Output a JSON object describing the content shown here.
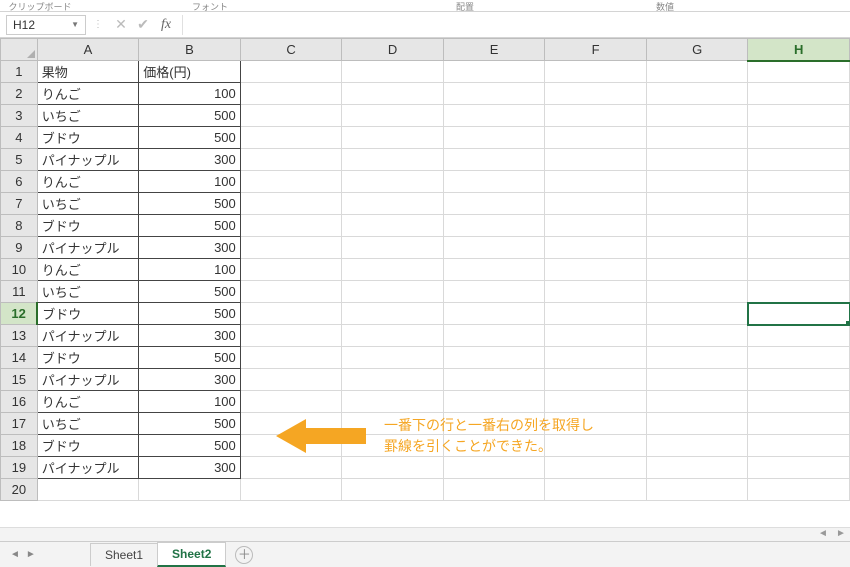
{
  "ribbon_groups": {
    "g1": "クリップボード",
    "g2": "フォント",
    "g3": "配置",
    "g4": "数値",
    "g5": ""
  },
  "name_box": "H12",
  "fx_label": "fx",
  "formula_value": "",
  "columns": [
    "A",
    "B",
    "C",
    "D",
    "E",
    "F",
    "G",
    "H"
  ],
  "row_count": 20,
  "active": {
    "row": 12,
    "col": "H"
  },
  "table": {
    "header": {
      "a": "果物",
      "b": "価格(円)"
    },
    "rows": [
      {
        "a": "りんご",
        "b": "100"
      },
      {
        "a": "いちご",
        "b": "500"
      },
      {
        "a": "ブドウ",
        "b": "500"
      },
      {
        "a": "パイナップル",
        "b": "300"
      },
      {
        "a": "りんご",
        "b": "100"
      },
      {
        "a": "いちご",
        "b": "500"
      },
      {
        "a": "ブドウ",
        "b": "500"
      },
      {
        "a": "パイナップル",
        "b": "300"
      },
      {
        "a": "りんご",
        "b": "100"
      },
      {
        "a": "いちご",
        "b": "500"
      },
      {
        "a": "ブドウ",
        "b": "500"
      },
      {
        "a": "パイナップル",
        "b": "300"
      },
      {
        "a": "ブドウ",
        "b": "500"
      },
      {
        "a": "パイナップル",
        "b": "300"
      },
      {
        "a": "りんご",
        "b": "100"
      },
      {
        "a": "いちご",
        "b": "500"
      },
      {
        "a": "ブドウ",
        "b": "500"
      },
      {
        "a": "パイナップル",
        "b": "300"
      }
    ]
  },
  "callout": {
    "line1": "一番下の行と一番右の列を取得し",
    "line2": "罫線を引くことができた。"
  },
  "tabs": {
    "sheet1": "Sheet1",
    "sheet2": "Sheet2",
    "add": "＋"
  },
  "chart_data": {
    "type": "table",
    "columns": [
      "果物",
      "価格(円)"
    ],
    "rows": [
      [
        "りんご",
        100
      ],
      [
        "いちご",
        500
      ],
      [
        "ブドウ",
        500
      ],
      [
        "パイナップル",
        300
      ],
      [
        "りんご",
        100
      ],
      [
        "いちご",
        500
      ],
      [
        "ブドウ",
        500
      ],
      [
        "パイナップル",
        300
      ],
      [
        "りんご",
        100
      ],
      [
        "いちご",
        500
      ],
      [
        "ブドウ",
        500
      ],
      [
        "パイナップル",
        300
      ],
      [
        "ブドウ",
        500
      ],
      [
        "パイナップル",
        300
      ],
      [
        "りんご",
        100
      ],
      [
        "いちご",
        500
      ],
      [
        "ブドウ",
        500
      ],
      [
        "パイナップル",
        300
      ]
    ]
  }
}
